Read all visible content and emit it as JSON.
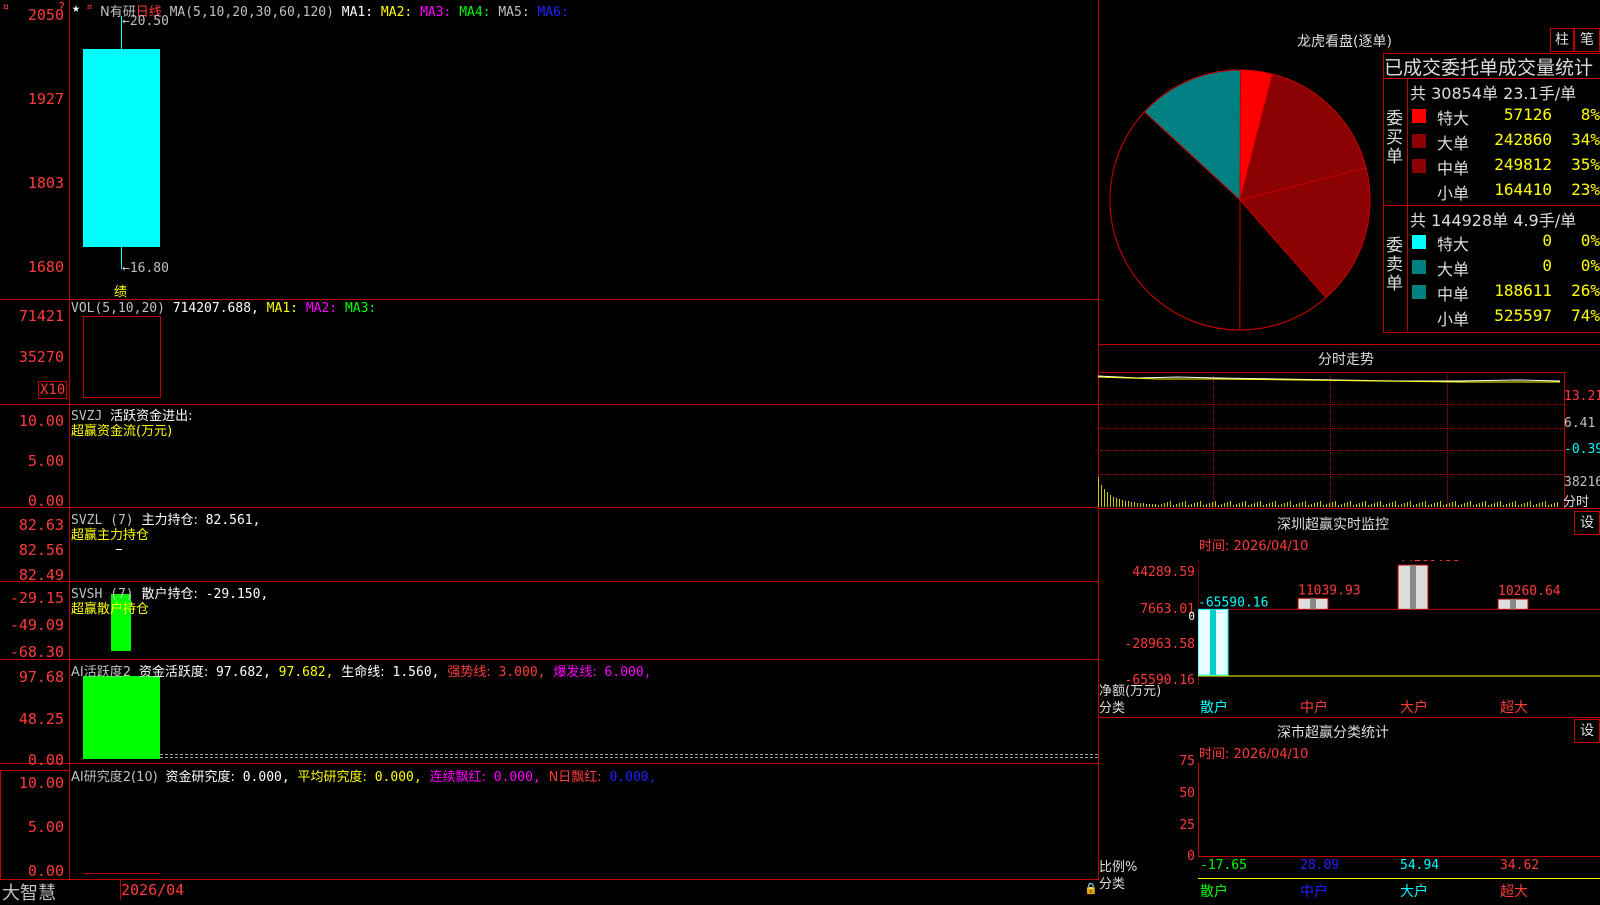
{
  "app": {
    "logo": "大智慧",
    "date_axis": "2026/04"
  },
  "kline": {
    "stock": "N有研",
    "period": "日线",
    "ma_params": "MA(5,10,20,30,60,120)",
    "ma_labels": [
      "MA1:",
      "MA2:",
      "MA3:",
      "MA4:",
      "MA5:",
      "MA6:"
    ],
    "high_label": "20.50",
    "low_label": "16.80",
    "marker": "绩",
    "axis": [
      "2050",
      "1927",
      "1803",
      "1680"
    ],
    "candle": {
      "open": 19.9,
      "close": 16.9,
      "high": 20.5,
      "low": 16.8
    }
  },
  "vol": {
    "title": "VOL(5,10,20)",
    "value": "714207.688,",
    "ma_labels": [
      "MA1:",
      "MA2:",
      "MA3:"
    ],
    "axis": [
      "71421",
      "35270"
    ],
    "unit": "X10"
  },
  "svzj": {
    "title": "SVZJ",
    "name": "活跃资金进出:",
    "sub": "超赢资金流(万元)",
    "axis": [
      "10.00",
      "5.00",
      "0.00"
    ]
  },
  "svzl": {
    "title": "SVZL (7)",
    "name": "主力持仓:",
    "value": "82.561,",
    "sub": "超赢主力持仓",
    "axis": [
      "82.63",
      "82.56",
      "82.49"
    ]
  },
  "svsh": {
    "title": "SVSH (7)",
    "name": "散户持仓:",
    "value": "-29.150,",
    "sub": "超赢散户持仓",
    "axis": [
      "-29.15",
      "-49.09",
      "-68.30"
    ]
  },
  "active": {
    "title": "AI活跃度2",
    "items": [
      "资金活跃度:",
      "97.682,",
      "97.682,",
      "生命线:",
      "1.560,",
      "强势线:",
      "3.000,",
      "爆发线:",
      "6.000,"
    ],
    "axis": [
      "97.68",
      "48.25",
      "0.00"
    ]
  },
  "research": {
    "title": "AI研究度2(10)",
    "items": [
      "资金研究度:",
      "0.000,",
      "平均研究度:",
      "0.000,",
      "连续飘红:",
      "0.000,",
      "N日飘红:",
      "0.000,"
    ],
    "axis": [
      "10.00",
      "5.00",
      "0.00"
    ]
  },
  "dragon": {
    "title": "龙虎看盘(逐单)",
    "buttons": [
      "柱",
      "笔"
    ],
    "header": "已成交委托单成交量统计",
    "buy_label": "委买单",
    "sell_label": "委卖单",
    "buy_total": "共 30854单 23.1手/单",
    "sell_total": "共 144928单 4.9手/单",
    "buy_rows": [
      {
        "name": "特大",
        "vol": "57126",
        "pct": "8%",
        "color": "#ff0000"
      },
      {
        "name": "大单",
        "vol": "242860",
        "pct": "34%",
        "color": "#8b0000"
      },
      {
        "name": "中单",
        "vol": "249812",
        "pct": "35%",
        "color": "#8b0000"
      },
      {
        "name": "小单",
        "vol": "164410",
        "pct": "23%",
        "color": "#000000"
      }
    ],
    "sell_rows": [
      {
        "name": "特大",
        "vol": "0",
        "pct": "0%",
        "color": "#00ffff"
      },
      {
        "name": "大单",
        "vol": "0",
        "pct": "0%",
        "color": "#008080"
      },
      {
        "name": "中单",
        "vol": "188611",
        "pct": "26%",
        "color": "#008080"
      },
      {
        "name": "小单",
        "vol": "525597",
        "pct": "74%",
        "color": "#000000"
      }
    ]
  },
  "intraday": {
    "title": "分时走势",
    "axis": [
      "13.21",
      "6.41",
      "-0.39",
      "38216"
    ],
    "tab": "分时"
  },
  "sz_monitor": {
    "title": "深圳超赢实时监控",
    "time": "时间: 2026/04/10",
    "button": "设",
    "axis": [
      "44289.59",
      "7663.01",
      "0",
      "-28963.58",
      "-65590.16"
    ],
    "ylabel": "净额(万元)",
    "xlabel": "分类",
    "categories": [
      "散户",
      "中户",
      "大户",
      "超大"
    ],
    "values": [
      "-65590.16",
      "11039.93",
      "44289.59",
      "10260.64"
    ]
  },
  "sz_class": {
    "title": "深市超赢分类统计",
    "time": "时间: 2026/04/10",
    "button": "设",
    "axis": [
      "75",
      "50",
      "25",
      "0"
    ],
    "ylabel": "比例%",
    "xlabel": "分类",
    "categories": [
      "散户",
      "中户",
      "大户",
      "超大"
    ],
    "values": [
      "-17.65",
      "28.09",
      "54.94",
      "34.62"
    ]
  },
  "chart_data": [
    {
      "type": "pie",
      "title": "龙虎看盘(逐单)",
      "slices": [
        {
          "name": "买-特大",
          "value": 8,
          "color": "#ff0000"
        },
        {
          "name": "买-大单",
          "value": 34,
          "color": "#8b0000"
        },
        {
          "name": "买-中单",
          "value": 35,
          "color": "#8b0000"
        },
        {
          "name": "买-小单",
          "value": 23,
          "color": "#000000"
        }
      ],
      "sell_slices": [
        {
          "name": "卖-中单",
          "value": 26,
          "color": "#008080"
        },
        {
          "name": "卖-小单",
          "value": 74,
          "color": "#000000"
        }
      ]
    },
    {
      "type": "bar",
      "title": "深圳超赢实时监控",
      "categories": [
        "散户",
        "中户",
        "大户",
        "超大"
      ],
      "values": [
        -65590.16,
        11039.93,
        44289.59,
        10260.64
      ],
      "ylabel": "净额(万元)",
      "ylim": [
        -65590.16,
        44289.59
      ]
    },
    {
      "type": "bar",
      "title": "深市超赢分类统计",
      "categories": [
        "散户",
        "中户",
        "大户",
        "超大"
      ],
      "values": [
        -17.65,
        28.09,
        54.94,
        34.62
      ],
      "ylabel": "比例%",
      "ylim": [
        0,
        75
      ]
    }
  ]
}
